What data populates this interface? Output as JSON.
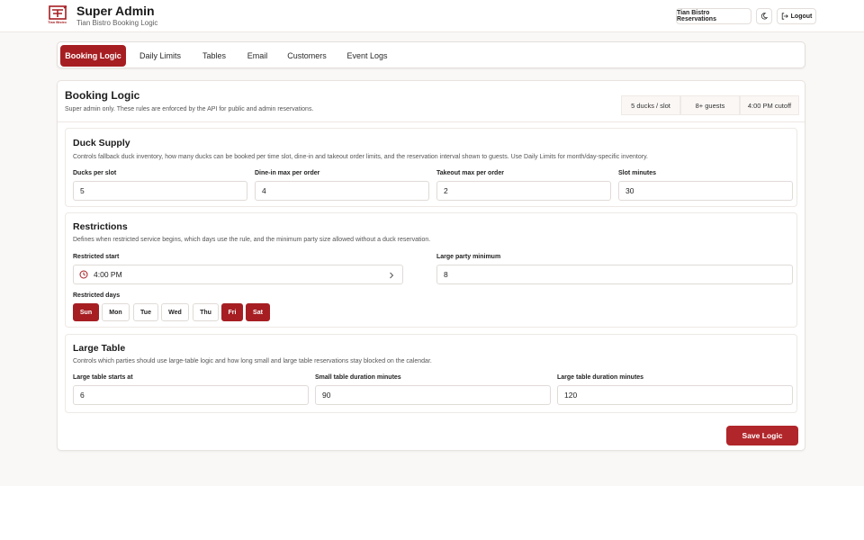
{
  "header": {
    "title": "Super Admin",
    "subtitle": "Tian Bistro Booking Logic",
    "logo_text": "Tian Bistro",
    "restaurant_button": "Tian Bistro Reservations",
    "theme_icon": "moon-icon",
    "logout_label": "Logout",
    "logout_icon": "logout-icon"
  },
  "nav": {
    "tabs": [
      {
        "label": "Booking Logic",
        "active": true
      },
      {
        "label": "Daily Limits",
        "active": false
      },
      {
        "label": "Tables",
        "active": false
      },
      {
        "label": "Email",
        "active": false
      },
      {
        "label": "Customers",
        "active": false
      },
      {
        "label": "Event Logs",
        "active": false
      }
    ]
  },
  "main": {
    "title": "Booking Logic",
    "description": "Super admin only. These rules are enforced by the API for public and admin reservations.",
    "stats": [
      "5 ducks / slot",
      "8+ guests",
      "4:00 PM cutoff"
    ]
  },
  "duck_supply": {
    "title": "Duck Supply",
    "description": "Controls fallback duck inventory, how many ducks can be booked per time slot, dine-in and takeout order limits, and the reservation interval shown to guests. Use Daily Limits for month/day-specific inventory.",
    "fields": [
      {
        "label": "Ducks per slot",
        "value": "5"
      },
      {
        "label": "Dine-in max per order",
        "value": "4"
      },
      {
        "label": "Takeout max per order",
        "value": "2"
      },
      {
        "label": "Slot minutes",
        "value": "30"
      }
    ]
  },
  "restrictions": {
    "title": "Restrictions",
    "description": "Defines when restricted service begins, which days use the rule, and the minimum party size allowed without a duck reservation.",
    "restricted_start_label": "Restricted start",
    "restricted_start_value": "4:00 PM",
    "clock_icon": "clock-icon",
    "large_party_label": "Large party minimum",
    "large_party_value": "8",
    "restricted_days_label": "Restricted days",
    "days": [
      {
        "label": "Sun",
        "on": true
      },
      {
        "label": "Mon",
        "on": false
      },
      {
        "label": "Tue",
        "on": false
      },
      {
        "label": "Wed",
        "on": false
      },
      {
        "label": "Thu",
        "on": false
      },
      {
        "label": "Fri",
        "on": true
      },
      {
        "label": "Sat",
        "on": true
      }
    ]
  },
  "large_table": {
    "title": "Large Table",
    "description": "Controls which parties should use large-table logic and how long small and large table reservations stay blocked on the calendar.",
    "fields": [
      {
        "label": "Large table starts at",
        "value": "6"
      },
      {
        "label": "Small table duration minutes",
        "value": "90"
      },
      {
        "label": "Large table duration minutes",
        "value": "120"
      }
    ]
  },
  "actions": {
    "save_label": "Save Logic"
  },
  "colors": {
    "accent": "#a61e22",
    "background": "#faf8f6"
  }
}
